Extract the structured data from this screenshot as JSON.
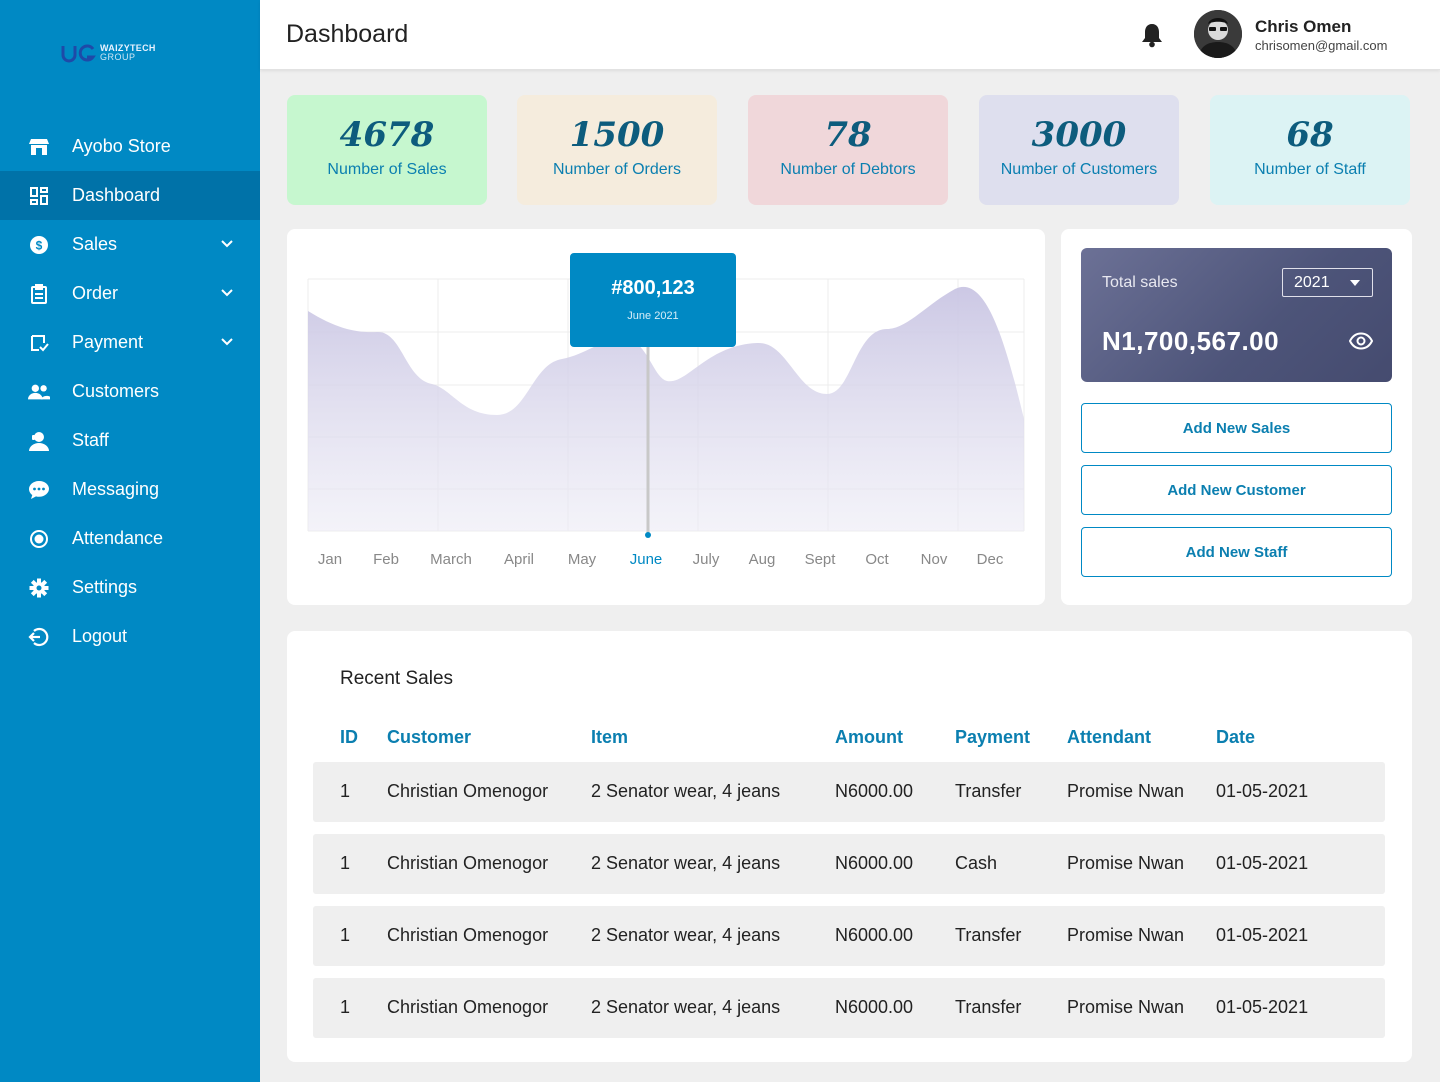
{
  "sidebar": {
    "logo": {
      "line1": "WAIZYTECH",
      "line2": "GROUP"
    },
    "items": [
      {
        "label": "Ayobo Store",
        "icon": "store-icon",
        "active": false
      },
      {
        "label": "Dashboard",
        "icon": "dashboard-icon",
        "active": true
      },
      {
        "label": "Sales",
        "icon": "dollar-icon",
        "active": false,
        "expandable": true
      },
      {
        "label": "Order",
        "icon": "clipboard-icon",
        "active": false,
        "expandable": true
      },
      {
        "label": "Payment",
        "icon": "payment-icon",
        "active": false,
        "expandable": true
      },
      {
        "label": "Customers",
        "icon": "customers-icon",
        "active": false
      },
      {
        "label": "Staff",
        "icon": "staff-icon",
        "active": false
      },
      {
        "label": "Messaging",
        "icon": "chat-icon",
        "active": false
      },
      {
        "label": "Attendance",
        "icon": "radio-icon",
        "active": false
      },
      {
        "label": "Settings",
        "icon": "gear-icon",
        "active": false
      },
      {
        "label": "Logout",
        "icon": "logout-icon",
        "active": false
      }
    ]
  },
  "header": {
    "title": "Dashboard",
    "user": {
      "name": "Chris Omen",
      "email": "chrisomen@gmail.com"
    }
  },
  "stats": [
    {
      "value": "4678",
      "label": "Number of Sales",
      "bg": "#c6f7cf"
    },
    {
      "value": "1500",
      "label": "Number of Orders",
      "bg": "#f5ecdd"
    },
    {
      "value": "78",
      "label": "Number of Debtors",
      "bg": "#f0d7da"
    },
    {
      "value": "3000",
      "label": "Number of Customers",
      "bg": "#dedfee"
    },
    {
      "value": "68",
      "label": "Number of Staff",
      "bg": "#dcf3f4"
    }
  ],
  "chart_data": {
    "type": "area",
    "categories": [
      "Jan",
      "Feb",
      "March",
      "April",
      "May",
      "June",
      "July",
      "Aug",
      "Sept",
      "Oct",
      "Nov",
      "Dec"
    ],
    "highlighted": "June",
    "tooltip": {
      "value": "#800,123",
      "label": "June 2021"
    },
    "grid": true,
    "colors": {
      "fill": "#c9c6e2",
      "active_label": "#0089c4",
      "label": "#888888"
    }
  },
  "summary": {
    "label": "Total sales",
    "year": "2021",
    "value": "N1,700,567.00"
  },
  "actions": [
    "Add New Sales",
    "Add New Customer",
    "Add New Staff"
  ],
  "recent_sales": {
    "title": "Recent Sales",
    "columns": [
      "ID",
      "Customer",
      "Item",
      "Amount",
      "Payment",
      "Attendant",
      "Date"
    ],
    "rows": [
      [
        "1",
        "Christian Omenogor",
        "2 Senator wear, 4 jeans",
        "N6000.00",
        "Transfer",
        "Promise Nwan",
        "01-05-2021"
      ],
      [
        "1",
        "Christian Omenogor",
        "2 Senator wear, 4 jeans",
        "N6000.00",
        "Cash",
        "Promise Nwan",
        "01-05-2021"
      ],
      [
        "1",
        "Christian Omenogor",
        "2 Senator wear, 4 jeans",
        "N6000.00",
        "Transfer",
        "Promise Nwan",
        "01-05-2021"
      ],
      [
        "1",
        "Christian Omenogor",
        "2 Senator wear, 4 jeans",
        "N6000.00",
        "Transfer",
        "Promise Nwan",
        "01-05-2021"
      ]
    ]
  }
}
